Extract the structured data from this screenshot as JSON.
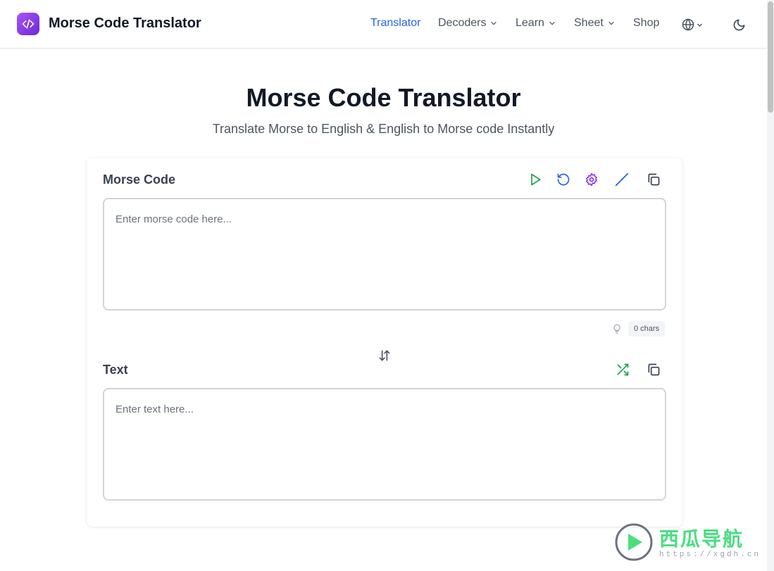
{
  "header": {
    "brand": "Morse Code Translator",
    "nav": [
      {
        "label": "Translator",
        "active": true
      },
      {
        "label": "Decoders"
      },
      {
        "label": "Learn"
      },
      {
        "label": "Sheet"
      },
      {
        "label": "Shop"
      }
    ]
  },
  "hero": {
    "title": "Morse Code Translator",
    "subtitle": "Translate Morse to English & English to Morse code Instantly"
  },
  "morse": {
    "label": "Morse Code",
    "placeholder": "Enter morse code here...",
    "value": "",
    "chars": "0 chars",
    "toolbar": [
      "play-icon",
      "reset-icon",
      "settings-icon",
      "slash-icon",
      "copy-icon"
    ]
  },
  "text": {
    "label": "Text",
    "placeholder": "Enter text here...",
    "value": "",
    "toolbar": [
      "shuffle-icon",
      "copy-icon"
    ]
  },
  "watermark": {
    "title": "西瓜导航",
    "url": "https://xgdh.cn"
  },
  "colors": {
    "accent": "#2563eb",
    "play": "#16a34a",
    "reset": "#2563eb",
    "settings": "#9333ea",
    "shuffle": "#16a34a"
  }
}
